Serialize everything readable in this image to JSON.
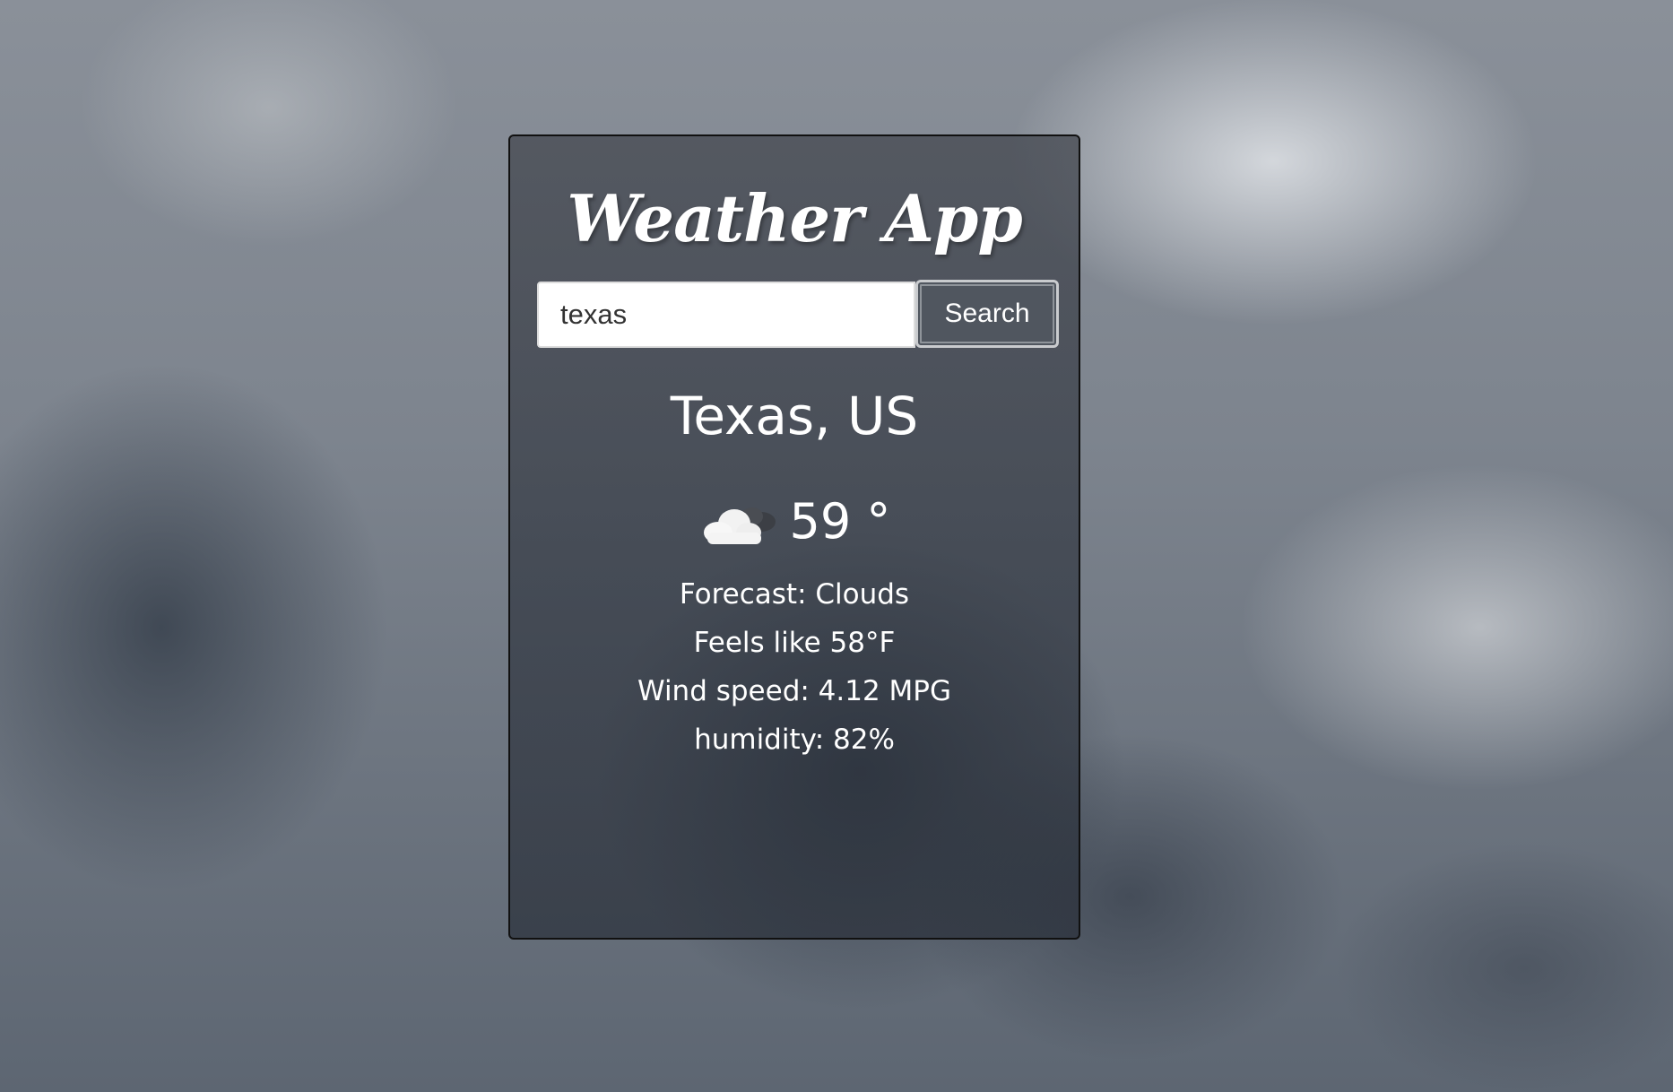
{
  "app": {
    "title": "Weather App"
  },
  "search": {
    "value": "texas",
    "button_label": "Search"
  },
  "weather": {
    "location": "Texas, US",
    "icon": "cloud-icon",
    "temperature": "59 °",
    "forecast": "Forecast: Clouds",
    "feels_like": "Feels like 58°F",
    "wind_speed": "Wind speed: 4.12 MPG",
    "humidity": "humidity: 82%"
  }
}
